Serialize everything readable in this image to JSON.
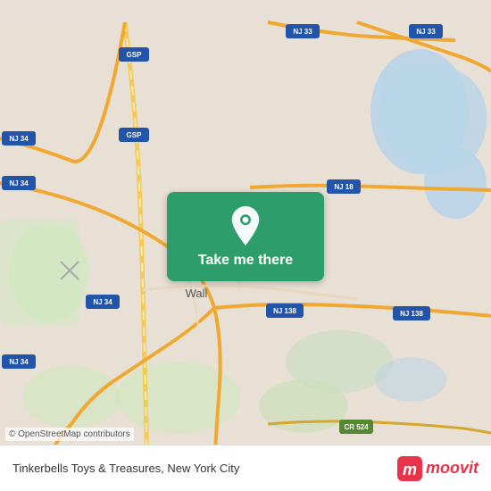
{
  "map": {
    "background_color": "#e8e0d8",
    "attribution": "© OpenStreetMap contributors"
  },
  "card": {
    "button_label": "Take me there",
    "background_color": "#2d9e6b"
  },
  "bottom_bar": {
    "location_name": "Tinkerbells Toys & Treasures, New York City"
  },
  "moovit": {
    "logo_text": "moovit"
  },
  "road_labels": {
    "nj34_1": "NJ 34",
    "nj34_2": "NJ 34",
    "nj34_3": "NJ 34",
    "nj34_4": "NJ 34",
    "nj33_1": "NJ 33",
    "nj33_2": "NJ 33",
    "nj18": "NJ 18",
    "nj138_1": "NJ 138",
    "nj138_2": "NJ 138",
    "gsp_1": "GSP",
    "gsp_2": "GSP",
    "cr524": "CR 524",
    "wall_label": "Wall"
  }
}
